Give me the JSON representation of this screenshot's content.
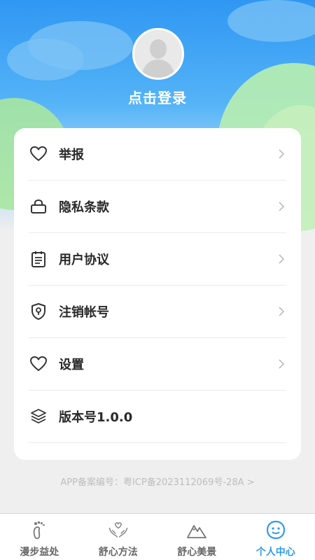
{
  "header": {
    "login_text": "点击登录"
  },
  "menu": {
    "items": [
      {
        "label": "举报",
        "icon": "heart-icon",
        "has_arrow": true
      },
      {
        "label": "隐私条款",
        "icon": "lock-icon",
        "has_arrow": true
      },
      {
        "label": "用户协议",
        "icon": "clipboard-icon",
        "has_arrow": true
      },
      {
        "label": "注销帐号",
        "icon": "shield-lock-icon",
        "has_arrow": true
      },
      {
        "label": "设置",
        "icon": "heart-icon",
        "has_arrow": true
      },
      {
        "label": "版本号1.0.0",
        "icon": "layers-icon",
        "has_arrow": false
      }
    ]
  },
  "footer": {
    "icp_text": "APP备案编号：粤ICP备2023112069号-28A >"
  },
  "tabbar": {
    "tabs": [
      {
        "label": "漫步益处",
        "icon": "footprint-icon",
        "active": false
      },
      {
        "label": "舒心方法",
        "icon": "hands-heart-icon",
        "active": false
      },
      {
        "label": "舒心美景",
        "icon": "mountain-icon",
        "active": false
      },
      {
        "label": "个人中心",
        "icon": "smiley-icon",
        "active": true
      }
    ]
  },
  "colors": {
    "accent": "#2e9af0",
    "header_top": "#2f97f3",
    "hill_green": "#a9e6a1"
  }
}
